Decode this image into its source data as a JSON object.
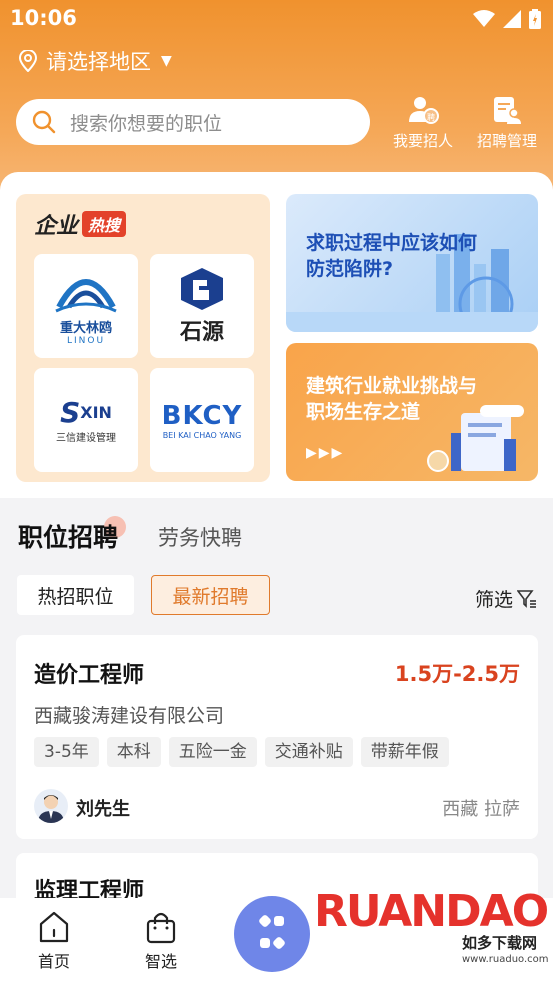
{
  "status_bar": {
    "time": "10:06"
  },
  "header": {
    "location": "请选择地区",
    "search_placeholder": "搜索你想要的职位",
    "actions": [
      {
        "label": "我要招人",
        "icon": "recruit-person-icon"
      },
      {
        "label": "招聘管理",
        "icon": "recruit-manage-icon"
      }
    ]
  },
  "hot": {
    "title": "企业",
    "badge": "热搜",
    "companies": [
      {
        "name": "重大林鸥",
        "sub": "LINOU"
      },
      {
        "name": "石源",
        "sub": ""
      },
      {
        "name": "XIN",
        "sub": "三信建设管理"
      },
      {
        "name": "BKCY",
        "sub": "BEI KAI CHAO YANG"
      }
    ]
  },
  "banners": [
    {
      "line1": "求职过程中应该如何",
      "line2": "防范陷阱?"
    },
    {
      "line1": "建筑行业就业挑战与",
      "line2": "职场生存之道"
    }
  ],
  "tabs": {
    "main": "职位招聘",
    "other": "劳务快聘"
  },
  "filters": {
    "hot": "热招职位",
    "new": "最新招聘",
    "screen": "筛选"
  },
  "jobs": [
    {
      "title": "造价工程师",
      "salary": "1.5万-2.5万",
      "company": "西藏骏涛建设有限公司",
      "tags": [
        "3-5年",
        "本科",
        "五险一金",
        "交通补贴",
        "带薪年假"
      ],
      "person": "刘先生",
      "place": "西藏 拉萨"
    },
    {
      "title": "监理工程师"
    }
  ],
  "nav": {
    "home": "首页",
    "smart": "智选"
  },
  "watermark": {
    "text": "RUANDAO",
    "sub": "如多下载网",
    "url": "www.ruaduo.com"
  },
  "colors": {
    "accent": "#f0922e",
    "salary": "#d9431f",
    "hot_badge": "#e3422a",
    "new_chip": "#e07a2c"
  }
}
